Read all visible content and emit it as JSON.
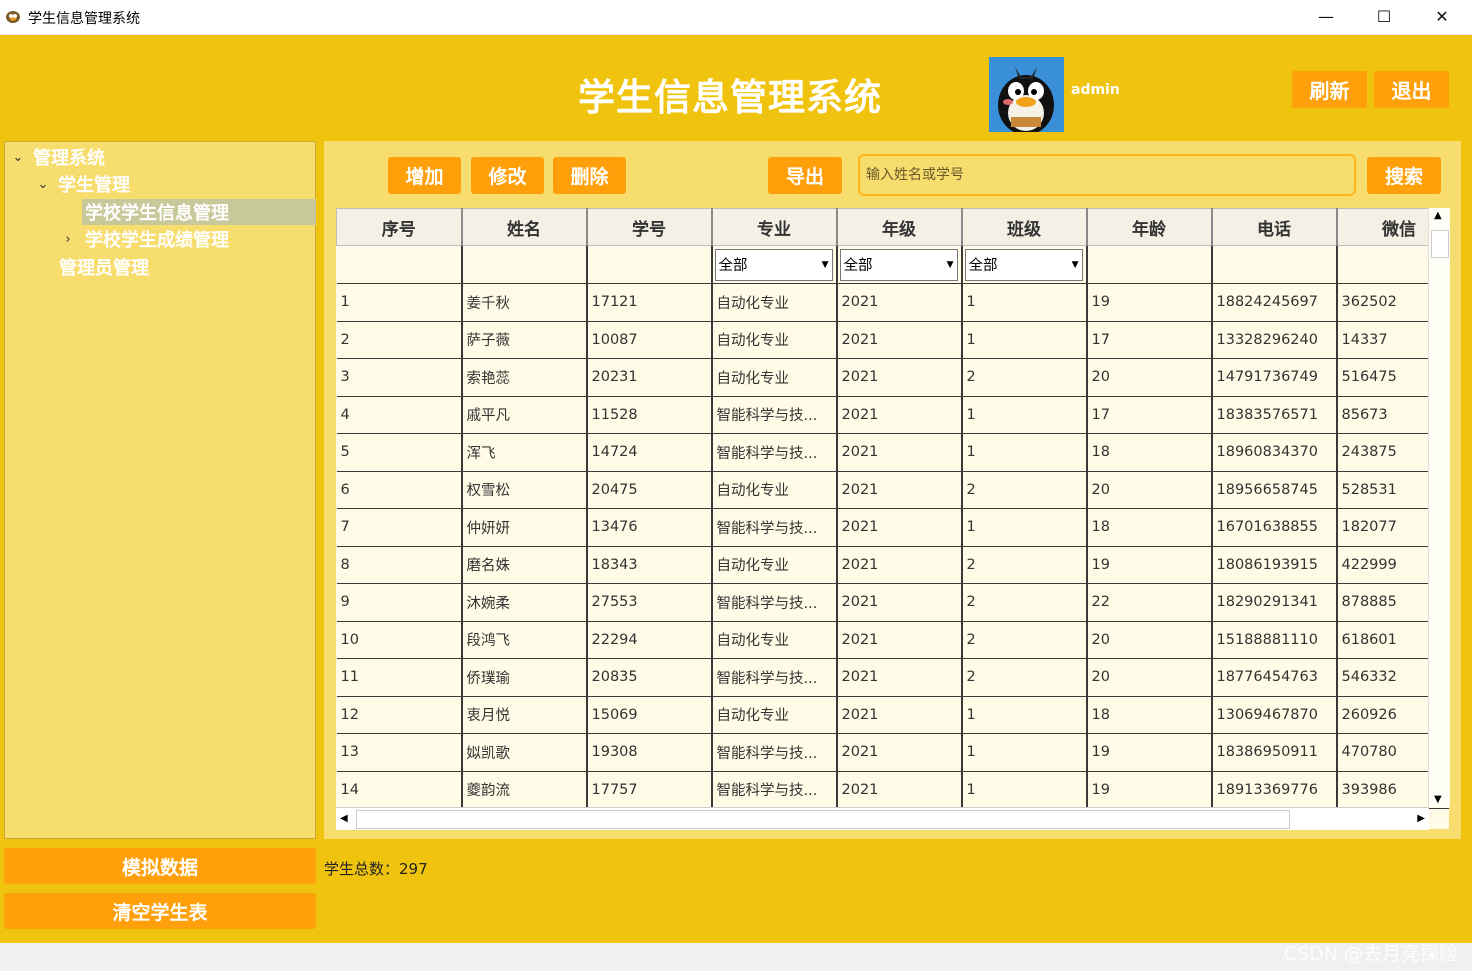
{
  "window": {
    "title": "学生信息管理系统",
    "minimize": "—",
    "maximize": "☐",
    "close": "✕"
  },
  "header": {
    "title": "学生信息管理系统",
    "username": "admin",
    "refresh_label": "刷新",
    "logout_label": "退出"
  },
  "sidebar": {
    "tree": [
      {
        "label": "管理系统",
        "expanded": true
      },
      {
        "label": "学生管理",
        "expanded": true
      },
      {
        "label": "学校学生信息管理",
        "selected": true
      },
      {
        "label": "学校学生成绩管理",
        "expanded": false
      },
      {
        "label": "管理员管理"
      }
    ],
    "mock_data_label": "模拟数据",
    "clear_table_label": "清空学生表"
  },
  "toolbar": {
    "add_label": "增加",
    "edit_label": "修改",
    "delete_label": "删除",
    "export_label": "导出",
    "search_placeholder": "输入姓名或学号",
    "search_label": "搜索"
  },
  "table": {
    "columns": [
      "序号",
      "姓名",
      "学号",
      "专业",
      "年级",
      "班级",
      "年龄",
      "电话",
      "微信"
    ],
    "filters": {
      "major": "全部",
      "grade": "全部",
      "class": "全部"
    },
    "rows": [
      [
        "1",
        "姜千秋",
        "17121",
        "自动化专业",
        "2021",
        "1",
        "19",
        "18824245697",
        "362502"
      ],
      [
        "2",
        "萨子薇",
        "10087",
        "自动化专业",
        "2021",
        "1",
        "17",
        "13328296240",
        "14337"
      ],
      [
        "3",
        "索艳蕊",
        "20231",
        "自动化专业",
        "2021",
        "2",
        "20",
        "14791736749",
        "516475"
      ],
      [
        "4",
        "戚平凡",
        "11528",
        "智能科学与技...",
        "2021",
        "1",
        "17",
        "18383576571",
        "85673"
      ],
      [
        "5",
        "浑飞",
        "14724",
        "智能科学与技...",
        "2021",
        "1",
        "18",
        "18960834370",
        "243875"
      ],
      [
        "6",
        "权雪松",
        "20475",
        "自动化专业",
        "2021",
        "2",
        "20",
        "18956658745",
        "528531"
      ],
      [
        "7",
        "仲妍妍",
        "13476",
        "智能科学与技...",
        "2021",
        "1",
        "18",
        "16701638855",
        "182077"
      ],
      [
        "8",
        "磨名姝",
        "18343",
        "自动化专业",
        "2021",
        "2",
        "19",
        "18086193915",
        "422999"
      ],
      [
        "9",
        "沐婉柔",
        "27553",
        "智能科学与技...",
        "2021",
        "2",
        "22",
        "18290291341",
        "878885"
      ],
      [
        "10",
        "段鸿飞",
        "22294",
        "自动化专业",
        "2021",
        "2",
        "20",
        "15188881110",
        "618601"
      ],
      [
        "11",
        "侨璞瑜",
        "20835",
        "智能科学与技...",
        "2021",
        "2",
        "20",
        "18776454763",
        "546332"
      ],
      [
        "12",
        "衷月悦",
        "15069",
        "自动化专业",
        "2021",
        "1",
        "18",
        "13069467870",
        "260926"
      ],
      [
        "13",
        "姒凯歌",
        "19308",
        "智能科学与技...",
        "2021",
        "1",
        "19",
        "18386950911",
        "470780"
      ],
      [
        "14",
        "夔韵流",
        "17757",
        "智能科学与技...",
        "2021",
        "1",
        "19",
        "18913369776",
        "393986"
      ]
    ]
  },
  "status": {
    "total_text": "学生总数：297"
  },
  "watermark": "CSDN @去月亮探险",
  "colors": {
    "background": "#f0c40e",
    "panel": "#f7dc6e",
    "button": "#ff9f0a",
    "text_light": "#ffffff"
  }
}
